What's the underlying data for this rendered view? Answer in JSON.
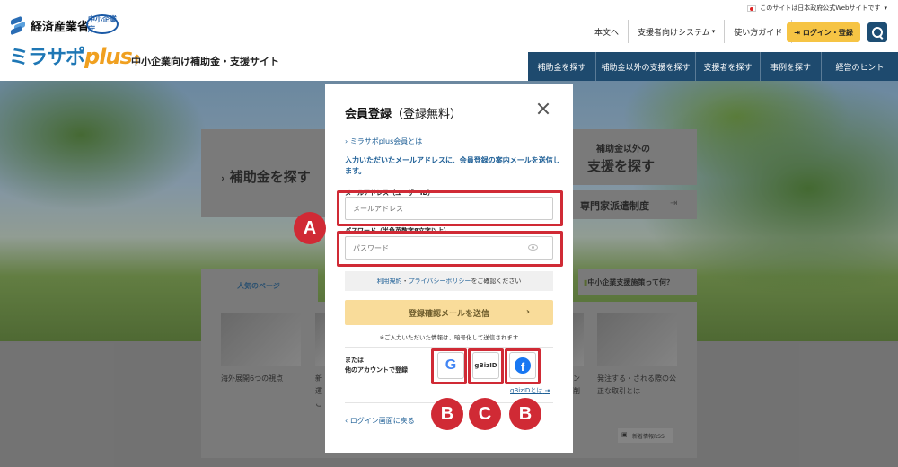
{
  "header": {
    "top_note": "このサイトは日本政府公式Webサイトです",
    "meti_name": "経済産業省",
    "chusho_emblem": "中小企業庁",
    "logo_main": "ミラサポ",
    "logo_plus": "plus",
    "tagline": "中小企業向け補助金・支援サイト",
    "utility_links": [
      "本文へ",
      "支援者向けシステム",
      "使い方ガイド"
    ],
    "login_label": "ログイン・登録",
    "main_nav": [
      "補助金を探す",
      "補助金以外の支援を探す",
      "支援者を探す",
      "事例を探す",
      "経営のヒント"
    ]
  },
  "background": {
    "search_subsidy": "補助金を探す",
    "other_support_line1": "補助金以外の",
    "other_support_line2": "支援を探す",
    "expert_dispatch": "専門家派遣制度",
    "popular_pages": "人気のページ",
    "sme_policy": "中小企業支援施策って何？",
    "article_left": "海外展開6つの視点",
    "article_mid_1": "新",
    "article_mid_2": "運",
    "article_mid_3": "こ",
    "article_right_1": "発注する・される際の公",
    "article_right_2": "正な取引とは",
    "article_right_side_1": "ン",
    "article_right_side_2": "削",
    "rss": "新着情報RSS"
  },
  "modal": {
    "title": "会員登録",
    "title_sub": "（登録無料）",
    "about_link": "ミラサポplus会員とは",
    "description": "入力いただいたメールアドレスに、会員登録の案内メールを送信します。",
    "email_label": "メールアドレス（ユーザーID）",
    "email_placeholder": "メールアドレス",
    "password_label": "パスワード（半角英数字8文字以上）",
    "password_placeholder": "パスワード",
    "terms_link1": "利用規約",
    "terms_sep": "・",
    "terms_link2": "プライバシーポリシー",
    "terms_suffix": "をご確認ください",
    "submit_label": "登録確認メールを送信",
    "encryption_note": "※ご入力いただいた情報は、暗号化して送信されます",
    "alt_login_line1": "または",
    "alt_login_line2": "他のアカウントで登録",
    "google_glyph": "G",
    "gbiz_glyph": "gBizID",
    "facebook_glyph": "f",
    "gbiz_about": "gBizIDとは",
    "back_link": "ログイン画面に戻る"
  },
  "annotations": {
    "badge_a": "A",
    "badge_b_left": "B",
    "badge_c": "C",
    "badge_b_right": "B",
    "color": "#d02a35"
  }
}
